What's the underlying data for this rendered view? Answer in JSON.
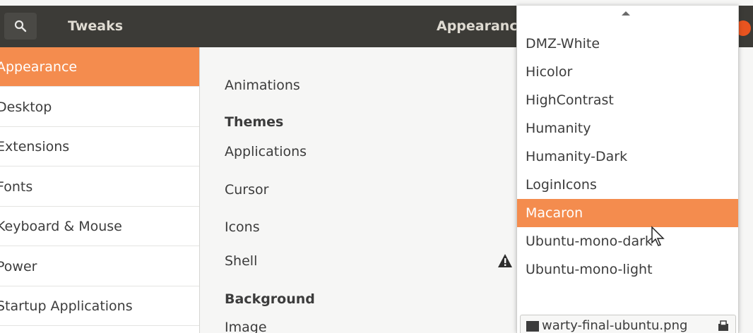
{
  "header": {
    "title": "Tweaks",
    "section": "Appearance",
    "search_icon": "search-icon",
    "close_icon": "close-icon"
  },
  "sidebar": {
    "items": [
      {
        "label": "Appearance",
        "selected": true
      },
      {
        "label": "Desktop"
      },
      {
        "label": "Extensions"
      },
      {
        "label": "Fonts"
      },
      {
        "label": "Keyboard & Mouse"
      },
      {
        "label": "Power"
      },
      {
        "label": "Startup Applications"
      }
    ]
  },
  "main": {
    "animations_label": "Animations",
    "themes_heading": "Themes",
    "applications_label": "Applications",
    "cursor_label": "Cursor",
    "icons_label": "Icons",
    "shell_label": "Shell",
    "background_heading": "Background",
    "image_label": "Image",
    "shell_warning_icon": "warning-icon"
  },
  "popup": {
    "items": [
      {
        "label": "DMZ-White"
      },
      {
        "label": "Hicolor"
      },
      {
        "label": "HighContrast"
      },
      {
        "label": "Humanity"
      },
      {
        "label": "Humanity-Dark"
      },
      {
        "label": "LoginIcons"
      },
      {
        "label": "Macaron",
        "selected": true
      },
      {
        "label": "Ubuntu-mono-dark"
      },
      {
        "label": "Ubuntu-mono-light"
      }
    ],
    "file_chooser": {
      "filename": "warty-final-ubuntu.png"
    }
  },
  "colors": {
    "accent": "#f48c4e",
    "headerbar": "#3c3b37",
    "close": "#e95420"
  }
}
